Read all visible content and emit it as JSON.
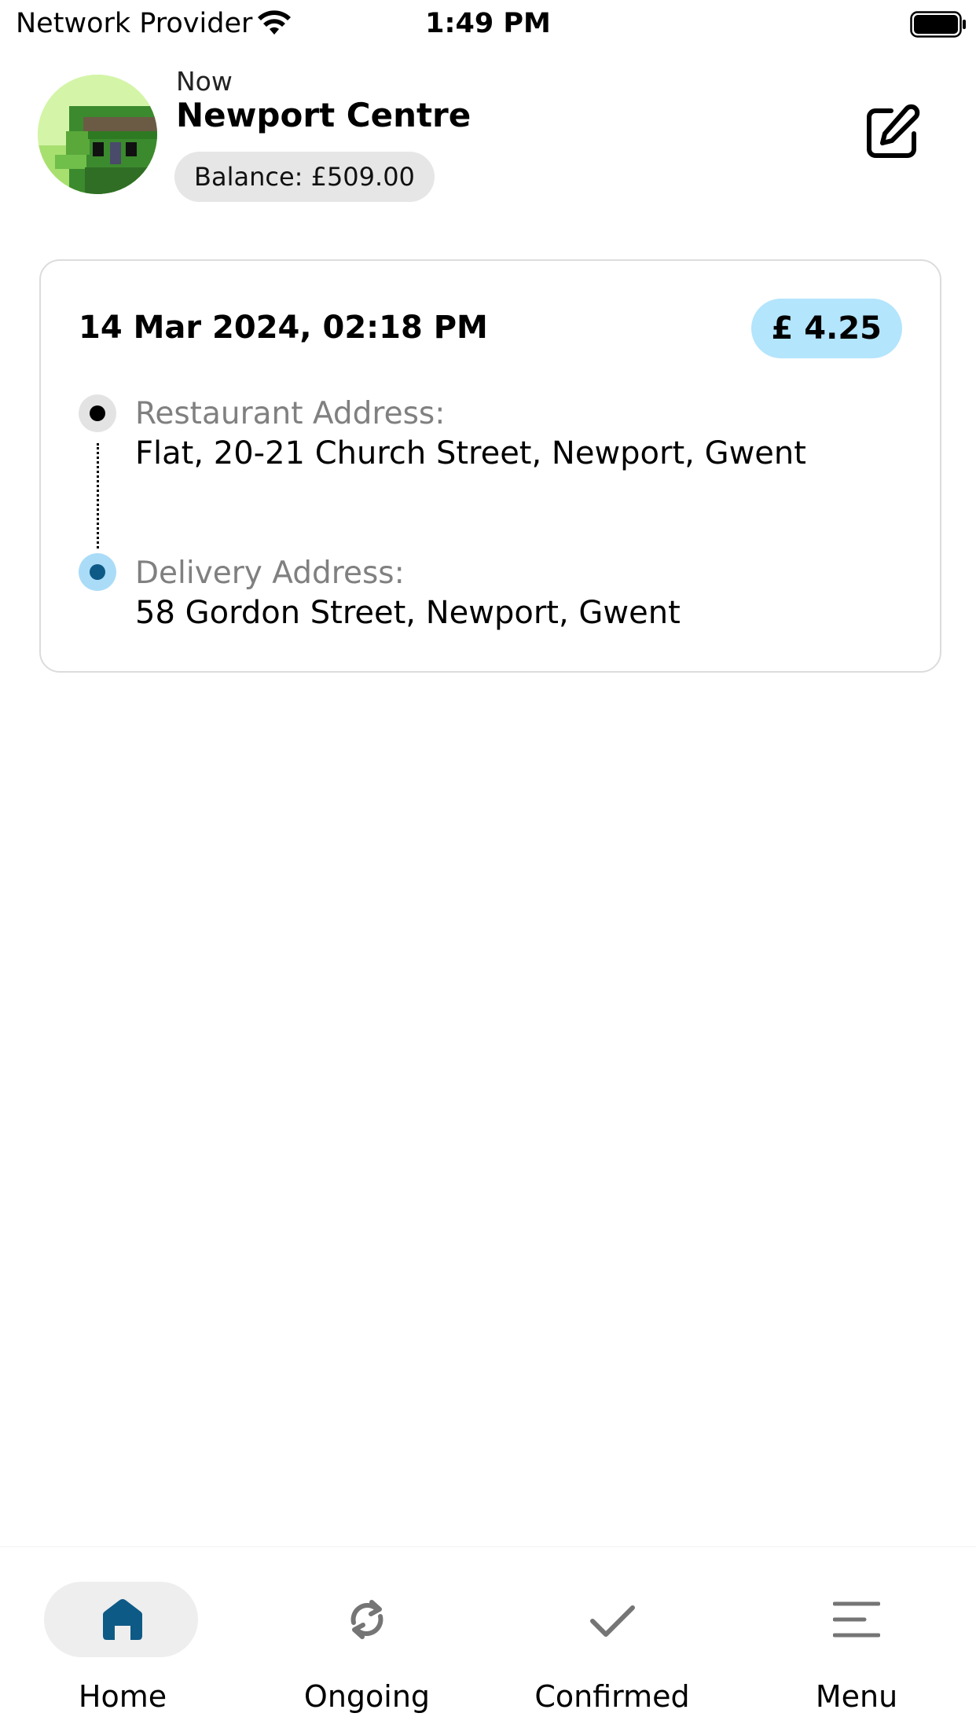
{
  "status_bar": {
    "carrier": "Network Provider",
    "time": "1:49 PM",
    "icons": [
      "wifi-icon",
      "battery-icon"
    ]
  },
  "header": {
    "subtitle": "Now",
    "title": "Newport Centre",
    "balance": "Balance: £509.00",
    "edit_icon": "edit-icon"
  },
  "order": {
    "date": "14 Mar 2024, 02:18 PM",
    "price": "£ 4.25",
    "restaurant_label": "Restaurant Address:",
    "restaurant_address": "Flat, 20-21 Church Street, Newport, Gwent",
    "delivery_label": "Delivery Address:",
    "delivery_address": "58 Gordon Street, Newport, Gwent"
  },
  "nav": {
    "items": [
      {
        "label": "Home",
        "icon": "home-icon",
        "active": true
      },
      {
        "label": "Ongoing",
        "icon": "refresh-icon",
        "active": false
      },
      {
        "label": "Confirmed",
        "icon": "check-icon",
        "active": false
      },
      {
        "label": "Menu",
        "icon": "menu-icon",
        "active": false
      }
    ]
  },
  "colors": {
    "price_pill": "#b3e5fc",
    "active_nav": "#0e5a86",
    "inactive_icon": "#757575",
    "balance_pill": "#e6e6e6"
  }
}
